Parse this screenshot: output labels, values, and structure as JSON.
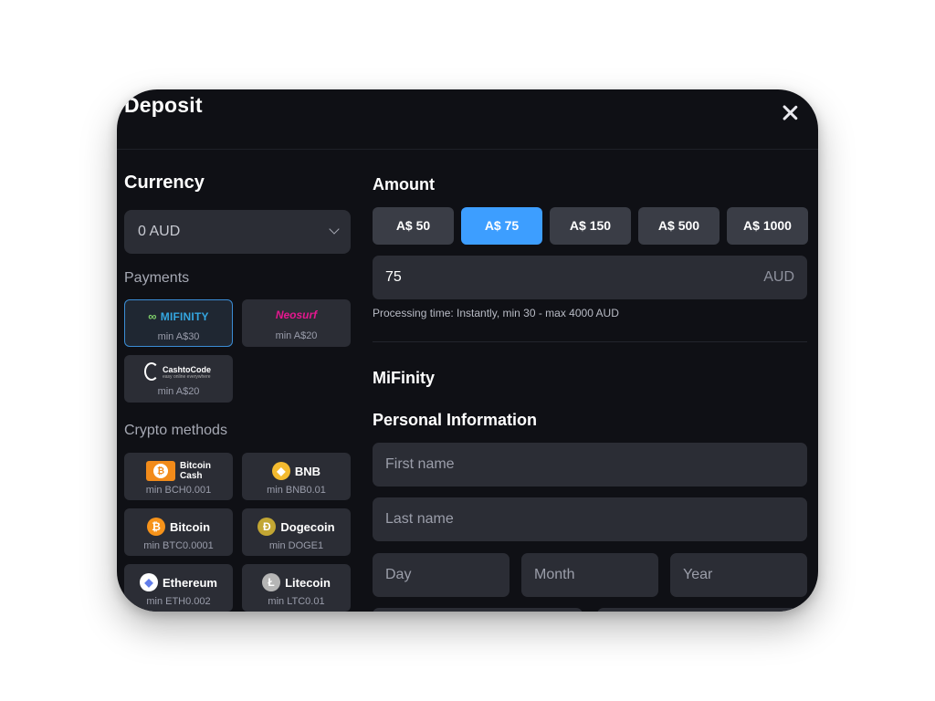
{
  "dialog": {
    "title": "Deposit",
    "close_label": "×"
  },
  "currency": {
    "heading": "Currency",
    "selected": "0 AUD"
  },
  "payments": {
    "heading": "Payments",
    "items": [
      {
        "name": "MIFINITY",
        "min": "min A$30",
        "selected": true
      },
      {
        "name": "Neosurf",
        "min": "min A$20"
      },
      {
        "name": "CashtoCode",
        "tagline": "easy online everywhere",
        "min": "min A$20"
      }
    ]
  },
  "crypto": {
    "heading": "Crypto methods",
    "items": [
      {
        "name_line1": "Bitcoin",
        "name_line2": "Cash",
        "min": "min BCH0.001",
        "color": "#f28b1a"
      },
      {
        "name": "BNB",
        "min": "min BNB0.01",
        "color": "#f3ba2f"
      },
      {
        "name": "Bitcoin",
        "min": "min BTC0.0001",
        "color": "#f7931a"
      },
      {
        "name": "Dogecoin",
        "min": "min DOGE1",
        "color": "#c2a633"
      },
      {
        "name": "Ethereum",
        "min": "min ETH0.002",
        "color": "#627eea"
      },
      {
        "name": "Litecoin",
        "min": "min LTC0.01",
        "color": "#b5b5b5"
      }
    ]
  },
  "amount": {
    "heading": "Amount",
    "presets": [
      "A$ 50",
      "A$ 75",
      "A$ 150",
      "A$ 500",
      "A$ 1000"
    ],
    "active_preset": "A$ 75",
    "value": "75",
    "currency": "AUD",
    "processing_note": "Processing time: Instantly, min 30 - max 4000 AUD"
  },
  "method": {
    "name": "MiFinity"
  },
  "personal": {
    "heading": "Personal Information",
    "first_name_placeholder": "First name",
    "last_name_placeholder": "Last name",
    "day_placeholder": "Day",
    "month_placeholder": "Month",
    "year_placeholder": "Year"
  },
  "colors": {
    "accent": "#3d9eff",
    "background": "#0f1015",
    "field": "#2b2d35"
  }
}
